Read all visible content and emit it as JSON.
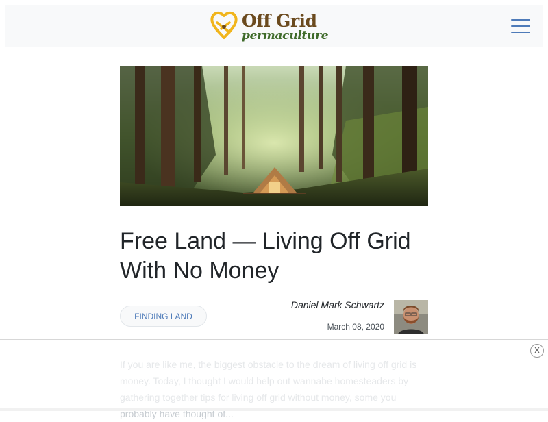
{
  "header": {
    "logo": {
      "line1": "Off Grid",
      "line2": "permaculture",
      "icon": "off-grid-logo-icon",
      "colors": {
        "mark": "#f1b51c",
        "line1": "#6b4a1e",
        "line2": "#3f6b2a"
      }
    },
    "menu_icon": "hamburger-icon",
    "menu_color": "#4e7bb9"
  },
  "hero": {
    "image": "forest-tent-photo"
  },
  "article": {
    "title": "Free Land — Living Off Grid With No Money",
    "category": "FINDING LAND",
    "author": "Daniel Mark Schwartz",
    "date": "March 08, 2020",
    "avatar": "author-avatar",
    "intro": "If you are like me, the biggest obstacle to the dream of living off grid is money. Today, I thought I would help out wannabe homesteaders by gathering together tips for living off grid without money, some you probably have thought of..."
  },
  "ad": {
    "close_label": "x"
  },
  "colors": {
    "link": "#4e7bb9",
    "text": "#212529",
    "muted": "#c7ccd1"
  }
}
